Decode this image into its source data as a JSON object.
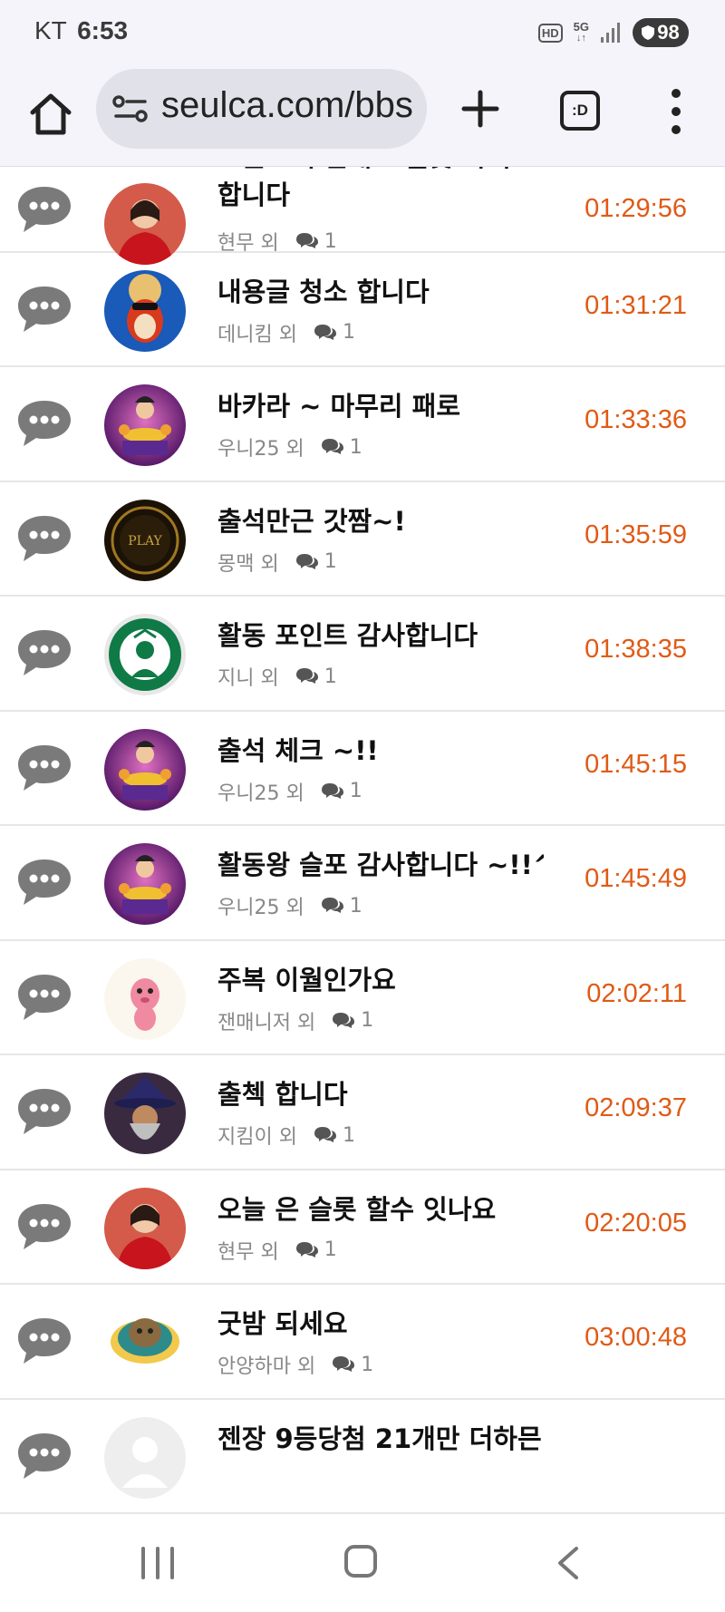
{
  "status_bar": {
    "carrier": "KT",
    "time": "6:53",
    "hd_badge": "HD",
    "network": "5G",
    "battery": "98"
  },
  "browser": {
    "url": "seulca.com/bbs",
    "tabs_label": ":D",
    "icons": [
      "home-icon",
      "site-settings-icon",
      "new-tab-plus-icon",
      "tab-switcher-icon",
      "more-menu-icon"
    ]
  },
  "posts": [
    {
      "title": "오늘도 루틴대로 슬롯 하려 합니다",
      "author": "현무 외",
      "comments": "1",
      "time": "01:29:56",
      "avatar": "woman-red"
    },
    {
      "title": "내용글 청소 합니다",
      "author": "데니킴 외",
      "comments": "1",
      "time": "01:31:21",
      "avatar": "bird-blue"
    },
    {
      "title": "바카라 ~ 마무리 패로",
      "author": "우니25 외",
      "comments": "1",
      "time": "01:33:36",
      "avatar": "slot-purple"
    },
    {
      "title": "출석만근 갓짬~!",
      "author": "몽맥 외",
      "comments": "1",
      "time": "01:35:59",
      "avatar": "logo-dark"
    },
    {
      "title": "활동 포인트 감사합니다",
      "author": "지니 외",
      "comments": "1",
      "time": "01:38:35",
      "avatar": "starbucks"
    },
    {
      "title": "출석 체크 ~!!",
      "author": "우니25 외",
      "comments": "1",
      "time": "01:45:15",
      "avatar": "slot-purple"
    },
    {
      "title": "활동왕 슬포 감사합니다 ~!!^^",
      "author": "우니25 외",
      "comments": "1",
      "time": "01:45:49",
      "avatar": "slot-purple"
    },
    {
      "title": "주복 이월인가요",
      "author": "잰매니저 외",
      "comments": "1",
      "time": "02:02:11",
      "avatar": "pink-character"
    },
    {
      "title": "출첵 합니다",
      "author": "지킴이 외",
      "comments": "1",
      "time": "02:09:37",
      "avatar": "wizard"
    },
    {
      "title": "오늘 은 슬롯 할수 잇나요",
      "author": "현무 외",
      "comments": "1",
      "time": "02:20:05",
      "avatar": "woman-red"
    },
    {
      "title": "굿밤 되세요",
      "author": "안양하마 외",
      "comments": "1",
      "time": "03:00:48",
      "avatar": "cat"
    },
    {
      "title": "젠장 9등당첨 21개만 더하믄",
      "author": "",
      "comments": "",
      "time": "",
      "avatar": "default-gray"
    }
  ],
  "colors": {
    "time_accent": "#e05a16",
    "title_text": "#111111",
    "meta_text": "#888888",
    "chat_icon": "#7a7a7a",
    "toolbar_bg": "#f4f4fa"
  },
  "nav_bar": {
    "icons": [
      "recent-apps-icon",
      "home-nav-icon",
      "back-nav-icon"
    ]
  }
}
